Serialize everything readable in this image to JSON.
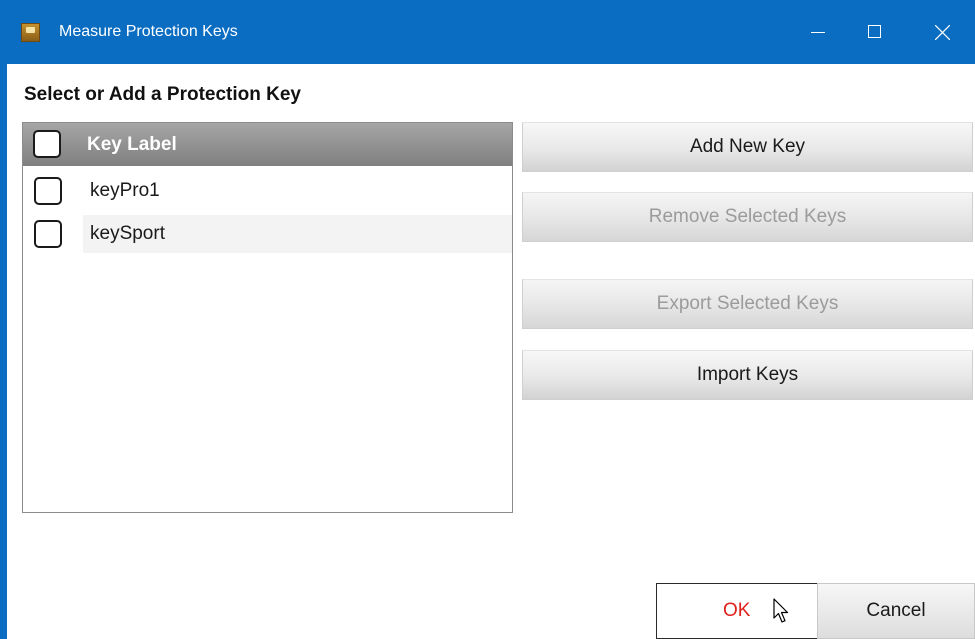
{
  "window": {
    "title": "Measure Protection Keys",
    "icon": "app-icon",
    "controls": [
      "minimize-icon",
      "maximize-icon",
      "close-icon"
    ]
  },
  "main": {
    "heading": "Select or Add a Protection Key",
    "list": {
      "column_header": "Key Label",
      "rows": [
        {
          "label": "keyPro1",
          "checked": false
        },
        {
          "label": "keySport",
          "checked": false
        }
      ]
    },
    "buttons": {
      "add": "Add New Key",
      "remove": "Remove Selected Keys",
      "export": "Export Selected Keys",
      "import": "Import Keys"
    }
  },
  "footer": {
    "ok": "OK",
    "cancel": "Cancel"
  },
  "colors": {
    "titlebar": "#0b6dc2",
    "ok_text": "#e0201a",
    "disabled_text": "#9b9b9b"
  }
}
